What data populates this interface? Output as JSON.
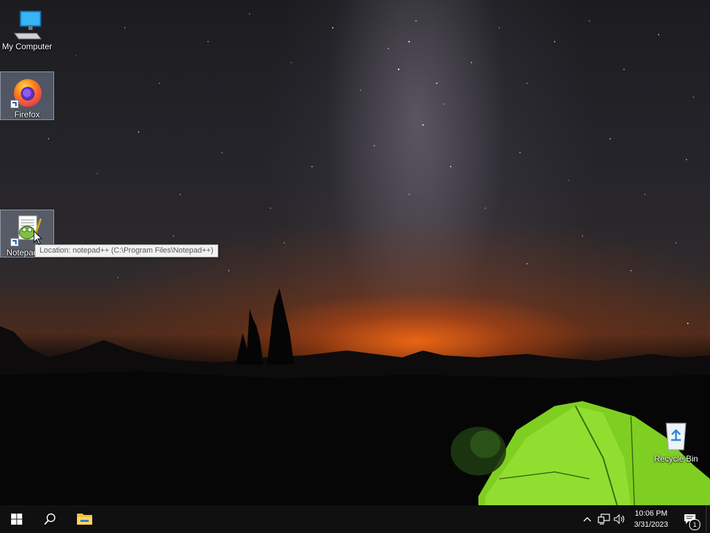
{
  "desktop": {
    "icons": [
      {
        "label": "My Computer"
      },
      {
        "label": "Firefox"
      },
      {
        "label": "Notepad++"
      },
      {
        "label": "Recycle Bin"
      }
    ],
    "tooltip": "Location: notepad++ (C:\\Program Files\\Notepad++)"
  },
  "taskbar": {
    "clock_time": "10:06 PM",
    "clock_date": "3/31/2023",
    "notification_count": "1"
  },
  "colors": {
    "taskbar": "#101010",
    "start_blue": "#ffffff",
    "tent_green": "#8fdc2a"
  }
}
